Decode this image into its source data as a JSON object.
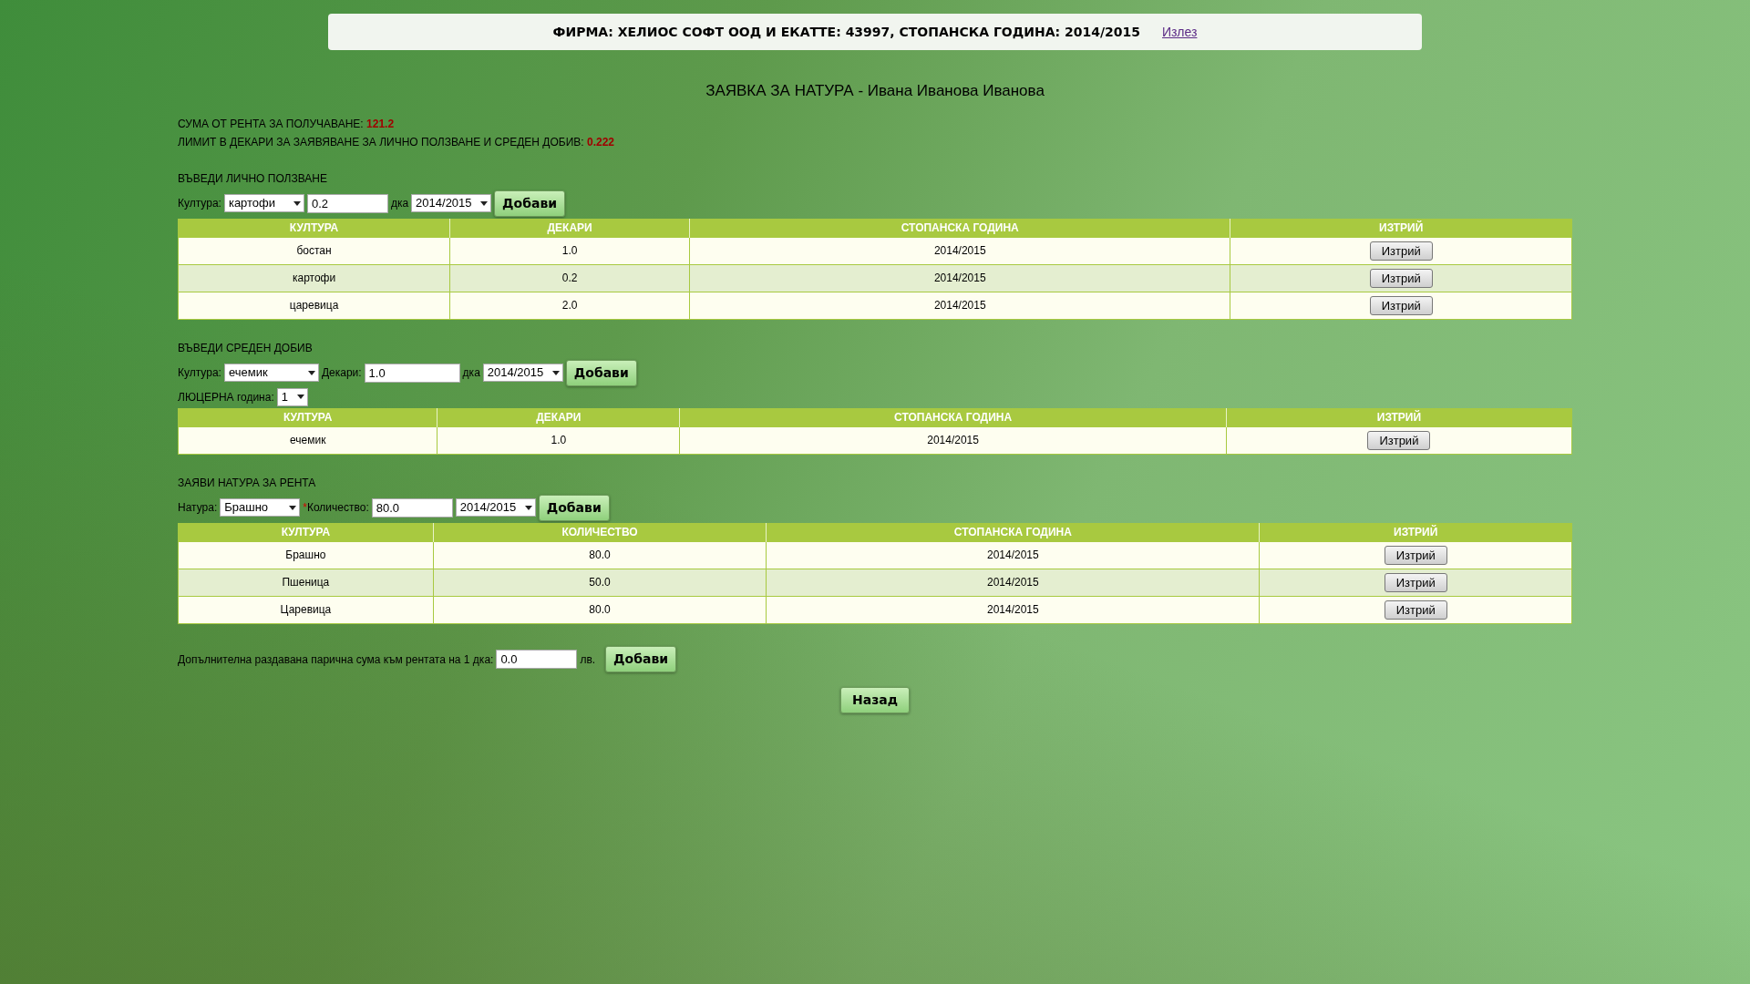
{
  "header": {
    "text": "ФИРМА: ХЕЛИОС СОФТ ООД И ЕКАТТЕ: 43997, СТОПАНСКА ГОДИНА: 2014/2015",
    "logout_link": "Излез"
  },
  "title": "ЗАЯВКА ЗА НАТУРА - Ивана Иванова Иванова",
  "summary": [
    {
      "label": "СУМА ОТ РЕНТА ЗА ПОЛУЧАВАНЕ:",
      "value": "121.2"
    },
    {
      "label": "ЛИМИТ В ДЕКАРИ ЗА ЗАЯВЯВАНЕ ЗА ЛИЧНО ПОЛЗВАНЕ И СРЕДЕН ДОБИВ:",
      "value": "0.222"
    }
  ],
  "sections": [
    {
      "heading": "ВЪВЕДИ ЛИЧНО ПОЛЗВАНЕ",
      "form_rows": [
        [
          {
            "kind": "label",
            "text": "Култура:"
          },
          {
            "kind": "select",
            "value": "картофи"
          },
          {
            "kind": "input",
            "value": "0.2"
          },
          {
            "kind": "label",
            "text": "дка"
          },
          {
            "kind": "select",
            "value": "2014/2015"
          },
          {
            "kind": "button",
            "text": "Добави"
          }
        ]
      ],
      "table": {
        "columns": [
          "КУЛТУРА",
          "ДЕКАРИ",
          "СТОПАНСКА ГОДИНА",
          "ИЗТРИЙ"
        ],
        "rows": [
          [
            "бостан",
            "1.0",
            "2014/2015",
            "Изтрий"
          ],
          [
            "картофи",
            "0.2",
            "2014/2015",
            "Изтрий"
          ],
          [
            "царевица",
            "2.0",
            "2014/2015",
            "Изтрий"
          ]
        ]
      }
    },
    {
      "heading": "ВЪВЕДИ СРЕДЕН ДОБИВ",
      "form_rows": [
        [
          {
            "kind": "label",
            "text": "Култура:"
          },
          {
            "kind": "select",
            "value": "ечемик"
          },
          {
            "kind": "label",
            "text": "Декари:"
          },
          {
            "kind": "input",
            "value": "1.0"
          },
          {
            "kind": "label",
            "text": "дка"
          },
          {
            "kind": "select",
            "value": "2014/2015"
          },
          {
            "kind": "button",
            "text": "Добави"
          }
        ],
        [
          {
            "kind": "label",
            "text": "ЛЮЦЕРНА година:"
          },
          {
            "kind": "select",
            "value": "1"
          }
        ]
      ],
      "table": {
        "columns": [
          "КУЛТУРА",
          "ДЕКАРИ",
          "СТОПАНСКА ГОДИНА",
          "ИЗТРИЙ"
        ],
        "rows": [
          [
            "ечемик",
            "1.0",
            "2014/2015",
            "Изтрий"
          ]
        ]
      }
    },
    {
      "heading": "ЗАЯВИ НАТУРА ЗА РЕНТА",
      "form_rows": [
        [
          {
            "kind": "label",
            "text": "Натура:"
          },
          {
            "kind": "select",
            "value": "Брашно"
          },
          {
            "kind": "label",
            "text": "Количество:",
            "mark": "*"
          },
          {
            "kind": "input",
            "value": "80.0"
          },
          {
            "kind": "select",
            "value": "2014/2015"
          },
          {
            "kind": "button",
            "text": "Добави"
          }
        ]
      ],
      "table": {
        "columns": [
          "КУЛТУРА",
          "КОЛИЧЕСТВО",
          "СТОПАНСКА ГОДИНА",
          "ИЗТРИЙ"
        ],
        "rows": [
          [
            "Брашно",
            "80.0",
            "2014/2015",
            "Изтрий"
          ],
          [
            "Пшеница",
            "50.0",
            "2014/2015",
            "Изтрий"
          ],
          [
            "Царевица",
            "80.0",
            "2014/2015",
            "Изтрий"
          ]
        ]
      }
    }
  ],
  "extra": [
    {
      "kind": "label",
      "text": "Допълнителна раздавана парична сума към рентата на 1 дка:"
    },
    {
      "kind": "input",
      "value": "0.0"
    },
    {
      "kind": "label",
      "text": "лв."
    },
    {
      "kind": "button",
      "text": "Добави"
    }
  ],
  "back_button": "Назад"
}
